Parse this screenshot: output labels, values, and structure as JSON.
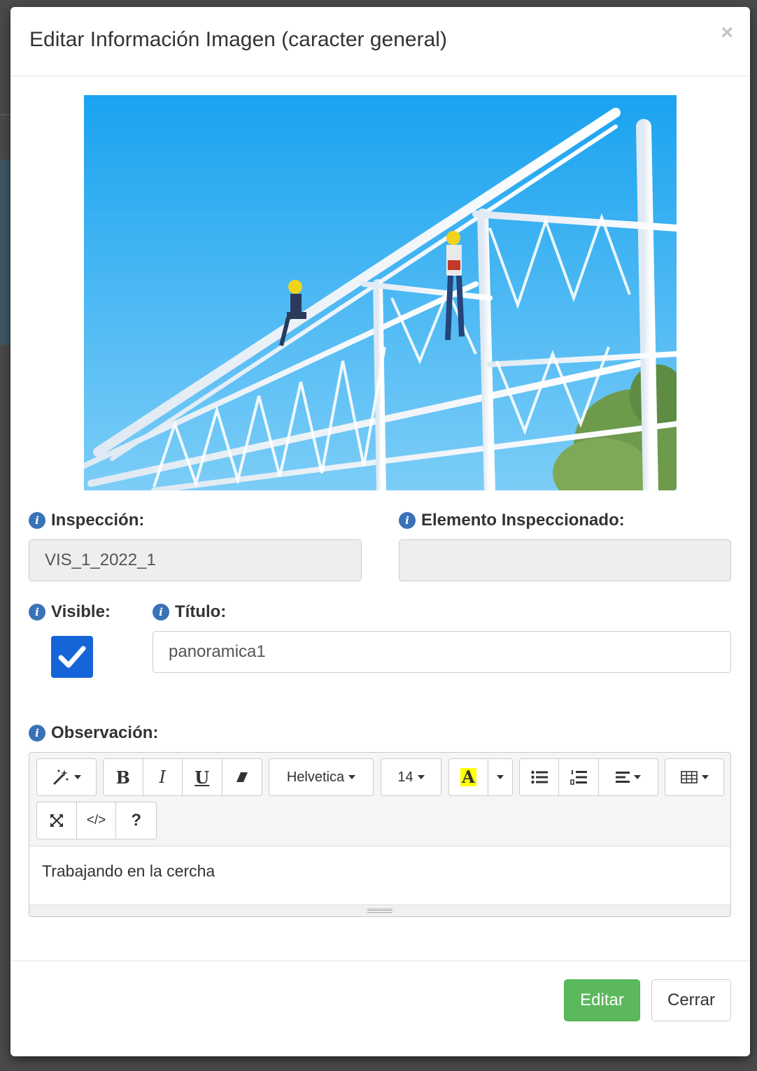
{
  "modal": {
    "title": "Editar Información Imagen (caracter general)",
    "close_symbol": "×"
  },
  "photo": {
    "description_icon": "construction-photo"
  },
  "form": {
    "inspection": {
      "label": "Inspección:",
      "value": "VIS_1_2022_1"
    },
    "element": {
      "label": "Elemento Inspeccionado:",
      "value": ""
    },
    "visible": {
      "label": "Visible:",
      "checked": true
    },
    "title": {
      "label": "Título:",
      "value": "panoramica1"
    },
    "observation": {
      "label": "Observación:"
    }
  },
  "editor": {
    "toolbar": {
      "font_name": "Helvetica",
      "font_size": "14",
      "bold": "B",
      "italic": "I",
      "underline": "U",
      "color_letter": "A",
      "help": "?",
      "code": "</>"
    },
    "content": "Trabajando en la cercha"
  },
  "footer": {
    "edit_label": "Editar",
    "close_label": "Cerrar"
  },
  "colors": {
    "primary_blue": "#1665d8",
    "info_blue": "#3a72b8",
    "success_green": "#5cb85c",
    "highlight_yellow": "#ffff00"
  }
}
